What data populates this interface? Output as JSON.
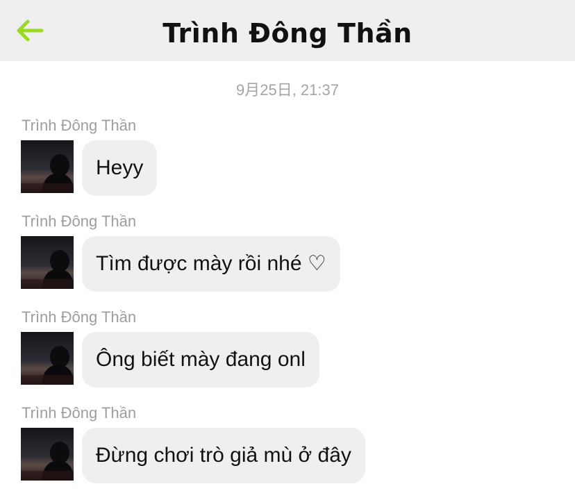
{
  "header": {
    "title": "Trình Đông Thần",
    "back_icon": "arrow-left-icon",
    "back_color": "#9bd821"
  },
  "timestamp": "9月25日, 21:37",
  "messages": [
    {
      "sender": "Trình Đông Thần",
      "text": "Heyy"
    },
    {
      "sender": "Trình Đông Thần",
      "text": "Tìm được mày rồi nhé ♡"
    },
    {
      "sender": "Trình Đông Thần",
      "text": "Ông biết mày đang onl"
    },
    {
      "sender": "Trình Đông Thần",
      "text": "Đừng chơi trò giả mù ở đây"
    }
  ]
}
